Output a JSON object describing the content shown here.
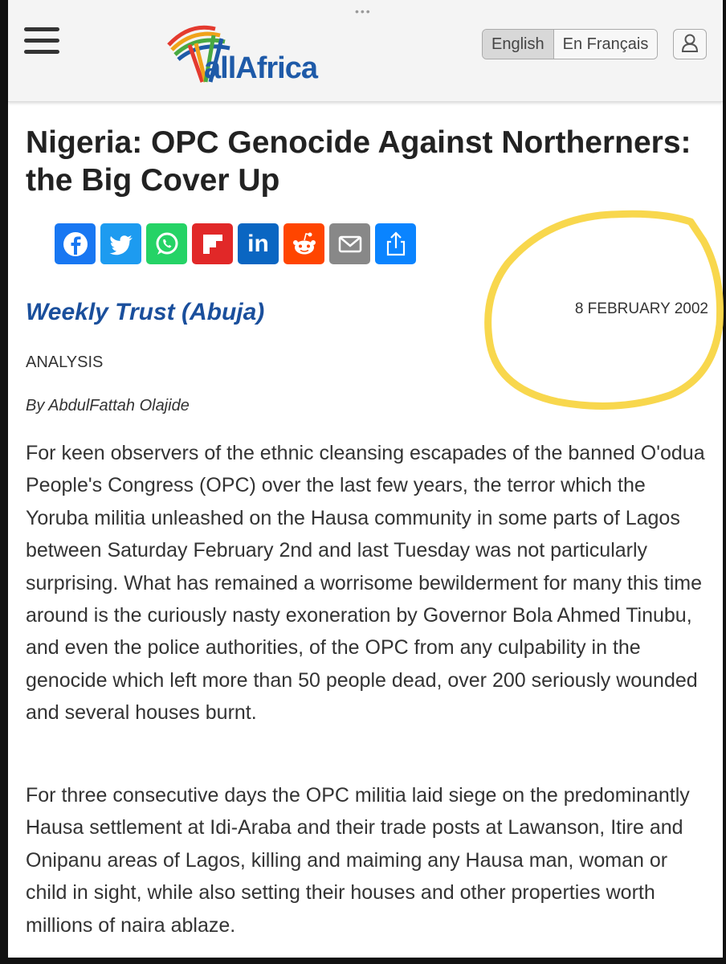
{
  "site": {
    "logo_text": "allAfrica"
  },
  "header": {
    "lang_english": "English",
    "lang_french": "En Français"
  },
  "article": {
    "title": "Nigeria: OPC Genocide Against Northerners: the Big Cover Up",
    "source": "Weekly Trust (Abuja)",
    "date": "8 FEBRUARY 2002",
    "kicker": "ANALYSIS",
    "byline": "By AbdulFattah Olajide",
    "paragraphs": [
      "For keen observers of the ethnic cleansing escapades of the banned O'odua People's Congress (OPC) over the last few years, the terror which the Yoruba militia unleashed on the Hausa community in some parts of Lagos between Saturday February 2nd and last Tuesday was not particularly surprising. What has remained a worrisome bewilderment for many this time around is the curiously nasty exoneration by Governor Bola Ahmed Tinubu, and even the police authorities, of the OPC from any culpability in the genocide which left more than 50 people dead, over 200 seriously wounded and several houses burnt.",
      "For three consecutive days the OPC militia laid siege on the predominantly Hausa settlement at Idi-Araba and their trade posts at Lawanson, Itire and Onipanu areas of Lagos, killing and maiming any Hausa man, woman or child in sight, while also setting their houses and other properties worth millions of naira ablaze."
    ]
  },
  "share_buttons": [
    {
      "name": "facebook",
      "color": "#1877f2"
    },
    {
      "name": "twitter",
      "color": "#1d9bf0"
    },
    {
      "name": "whatsapp",
      "color": "#25d366"
    },
    {
      "name": "flipboard",
      "color": "#e12828"
    },
    {
      "name": "linkedin",
      "color": "#0a66c2"
    },
    {
      "name": "reddit",
      "color": "#ff4500"
    },
    {
      "name": "email",
      "color": "#888888"
    },
    {
      "name": "share",
      "color": "#0a84ff"
    }
  ],
  "colors": {
    "accent": "#1a4f9c",
    "highlight": "#f7d33a"
  }
}
